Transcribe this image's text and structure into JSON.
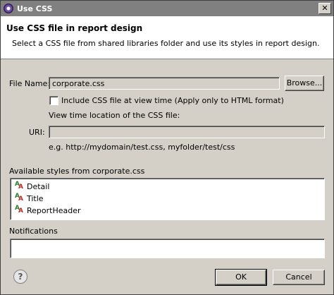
{
  "window": {
    "title": "Use CSS",
    "close_glyph": "✕"
  },
  "banner": {
    "title": "Use CSS file in report design",
    "description": "Select a CSS file from shared libraries folder and use its styles in report design."
  },
  "form": {
    "file_name_label": "File Name:",
    "file_name_value": "corporate.css",
    "browse_label": "Browse...",
    "include_checkbox_label": "Include CSS file at view time (Apply only to HTML format)",
    "include_checked": false,
    "view_time_location_label": "View time location of the CSS file:",
    "uri_label": "URI:",
    "uri_value": "",
    "uri_example": "e.g. http://mydomain/test.css, myfolder/test/css"
  },
  "styles": {
    "header": "Available styles from corporate.css",
    "items": [
      {
        "label": "Detail",
        "icon": "style-icon"
      },
      {
        "label": "Title",
        "icon": "style-icon"
      },
      {
        "label": "ReportHeader",
        "icon": "style-icon"
      }
    ]
  },
  "notifications": {
    "label": "Notifications",
    "value": ""
  },
  "footer": {
    "help_glyph": "?",
    "ok_label": "OK",
    "cancel_label": "Cancel"
  }
}
